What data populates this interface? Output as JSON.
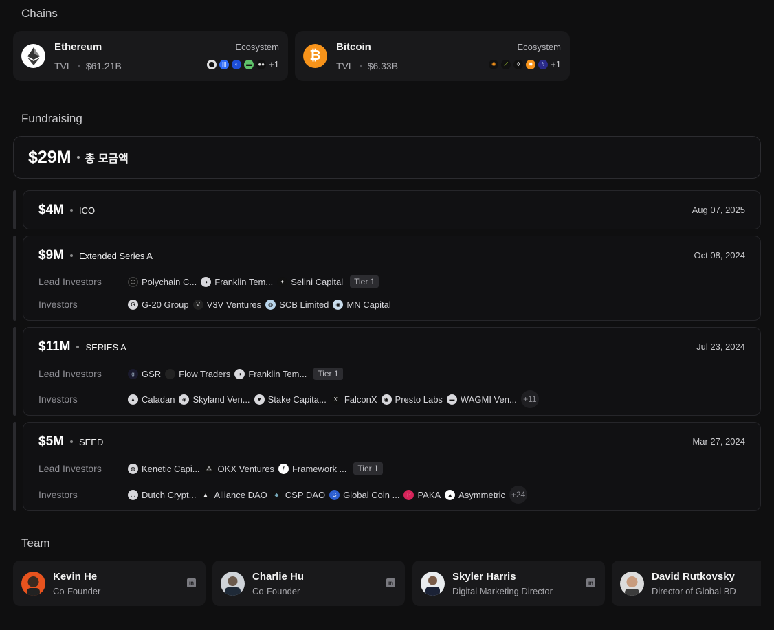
{
  "sections": {
    "chains": "Chains",
    "fundraising": "Fundraising",
    "team": "Team"
  },
  "chains": [
    {
      "name": "Ethereum",
      "tvl_label": "TVL",
      "tvl": "$61.21B",
      "ecosystem_label": "Ecosystem",
      "more": "+1",
      "logo": "ethereum-icon",
      "color": "#ffffff"
    },
    {
      "name": "Bitcoin",
      "tvl_label": "TVL",
      "tvl": "$6.33B",
      "ecosystem_label": "Ecosystem",
      "more": "+1",
      "logo": "bitcoin-icon",
      "color": "#f7931a"
    }
  ],
  "fundraising": {
    "total": "$29M",
    "total_label": "총 모금액",
    "rounds": [
      {
        "amount": "$4M",
        "type": "ICO",
        "date": "Aug 07, 2025"
      },
      {
        "amount": "$9M",
        "type": "Extended Series A",
        "date": "Oct 08, 2024",
        "lead_label": "Lead Investors",
        "investors_label": "Investors",
        "lead": [
          "Polychain C...",
          "Franklin Tem...",
          "Selini Capital"
        ],
        "tier": "Tier 1",
        "investors": [
          "G-20 Group",
          "V3V Ventures",
          "SCB Limited",
          "MN Capital"
        ]
      },
      {
        "amount": "$11M",
        "type": "SERIES A",
        "date": "Jul 23, 2024",
        "lead_label": "Lead Investors",
        "investors_label": "Investors",
        "lead": [
          "GSR",
          "Flow Traders",
          "Franklin Tem..."
        ],
        "tier": "Tier 1",
        "investors": [
          "Caladan",
          "Skyland Ven...",
          "Stake Capita...",
          "FalconX",
          "Presto Labs",
          "WAGMI Ven..."
        ],
        "more": "+11"
      },
      {
        "amount": "$5M",
        "type": "SEED",
        "date": "Mar 27, 2024",
        "lead_label": "Lead Investors",
        "investors_label": "Investors",
        "lead": [
          "Kenetic Capi...",
          "OKX Ventures",
          "Framework ..."
        ],
        "tier": "Tier 1",
        "investors": [
          "Dutch Crypt...",
          "Alliance DAO",
          "CSP DAO",
          "Global Coin ...",
          "PAKA",
          "Asymmetric"
        ],
        "more": "+24"
      }
    ]
  },
  "team": [
    {
      "name": "Kevin He",
      "role": "Co-Founder",
      "avatar_color": "#e8531e"
    },
    {
      "name": "Charlie Hu",
      "role": "Co-Founder",
      "avatar_color": "#cfd3d8"
    },
    {
      "name": "Skyler Harris",
      "role": "Digital Marketing Director",
      "avatar_color": "#e9ecef"
    },
    {
      "name": "David Rutkovsky",
      "role": "Director of Global BD",
      "avatar_color": "#dcdcdc"
    }
  ],
  "linkedin_icon_text": "in"
}
